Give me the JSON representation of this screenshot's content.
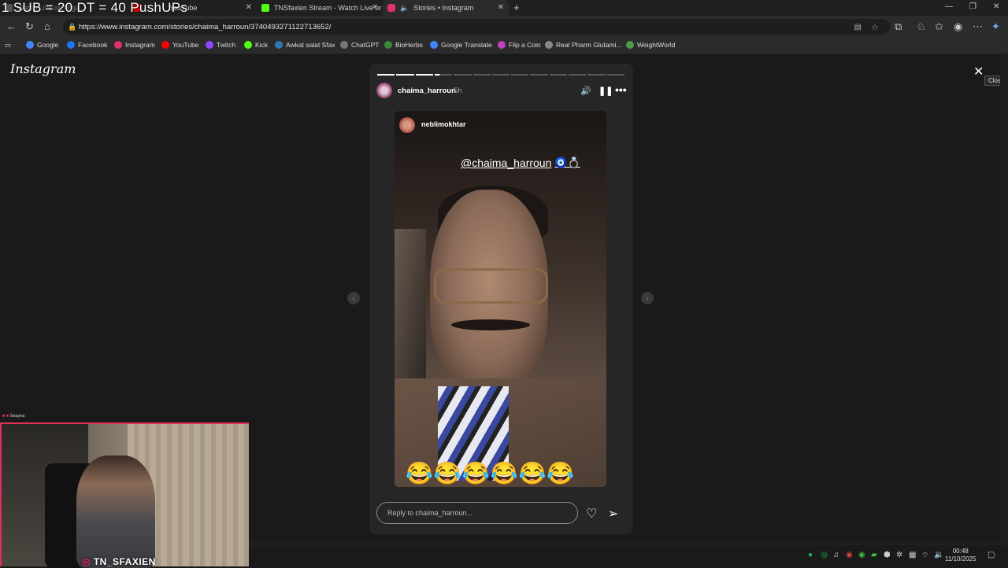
{
  "overlay_text": "1 SUB = 20 DT = 40 PushUPs",
  "tabs": [
    {
      "label": "Watch Live on Miga...",
      "active": false
    },
    {
      "label": "YouTube",
      "active": false
    },
    {
      "label": "TNSfaxien Stream - Watch Live or",
      "active": false
    },
    {
      "label": "Stories • Instagram",
      "active": true
    }
  ],
  "address": {
    "url": "https://www.instagram.com/stories/chaima_harroun/3740493271122713652/"
  },
  "bookmarks": [
    {
      "label": "Google",
      "color": "#4285f4"
    },
    {
      "label": "Facebook",
      "color": "#1877f2"
    },
    {
      "label": "Instagram",
      "color": "#e1306c"
    },
    {
      "label": "YouTube",
      "color": "#ff0000"
    },
    {
      "label": "Twitch",
      "color": "#9146ff"
    },
    {
      "label": "Kick",
      "color": "#53fc18"
    },
    {
      "label": "Awkat salat Sfax",
      "color": "#2a7ab0"
    },
    {
      "label": "ChatGPT",
      "color": "#777"
    },
    {
      "label": "BioHerbs",
      "color": "#3a8a3a"
    },
    {
      "label": "Google Translate",
      "color": "#4285f4"
    },
    {
      "label": "Flip a Coin",
      "color": "#c040c0"
    },
    {
      "label": "Real Pharm Glutami...",
      "color": "#888"
    },
    {
      "label": "WeightWorld",
      "color": "#4a9a4a"
    }
  ],
  "instagram": {
    "logo": "Instagram",
    "story": {
      "username": "chaima_harroun",
      "time": "5h",
      "segments_total": 13,
      "segments_viewed": 3,
      "inner_username": "neblimokhtar",
      "mention": "@chaima_harroun",
      "mention_emoji": "🧿💍",
      "emojis": "😂😂😂😂😂😂",
      "reply_placeholder": "Reply to chaima_harroun..."
    },
    "close_tooltip": "Close"
  },
  "webcam": {
    "header": "Snayna",
    "label": "TN_SFAXIEN"
  },
  "clock": {
    "time": "00:48",
    "date": "11/10/2025"
  }
}
